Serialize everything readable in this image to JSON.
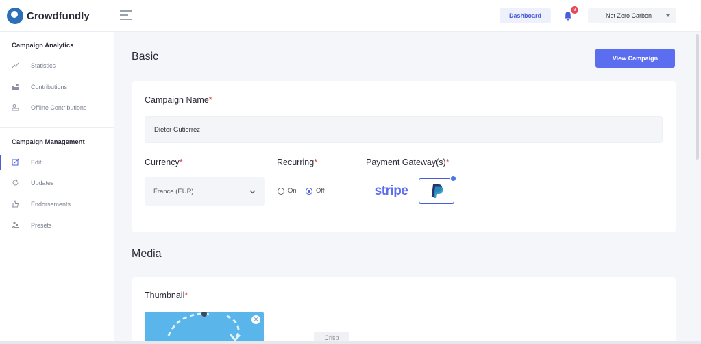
{
  "brand": {
    "name": "Crowdfundly",
    "color": "#2c6fb7"
  },
  "header": {
    "dashboard_label": "Dashboard",
    "notification_count": "9",
    "account_label": "Net Zero Carbon"
  },
  "sidebar": {
    "analytics_heading": "Campaign Analytics",
    "analytics_items": [
      {
        "label": "Statistics",
        "icon": "chart-line-icon"
      },
      {
        "label": "Contributions",
        "icon": "contributions-icon"
      },
      {
        "label": "Offline Contributions",
        "icon": "offline-contributions-icon"
      }
    ],
    "management_heading": "Campaign Management",
    "management_items": [
      {
        "label": "Edit",
        "icon": "edit-icon",
        "active": true
      },
      {
        "label": "Updates",
        "icon": "refresh-icon"
      },
      {
        "label": "Endorsements",
        "icon": "thumbs-up-icon"
      },
      {
        "label": "Presets",
        "icon": "sliders-icon"
      }
    ]
  },
  "basic": {
    "title": "Basic",
    "view_campaign_label": "View Campaign",
    "campaign_name_label": "Campaign Name",
    "campaign_name_value": "Dieter Gutierrez",
    "currency_label": "Currency",
    "currency_value": "France (EUR)",
    "recurring_label": "Recurring",
    "recurring_options": [
      "On",
      "Off"
    ],
    "recurring_selected": "Off",
    "payment_gateway_label": "Payment Gateway(s)",
    "gateways": [
      "stripe",
      "PayPal"
    ],
    "selected_gateway": "PayPal"
  },
  "media": {
    "title": "Media",
    "thumbnail_label": "Thumbnail"
  },
  "widget": {
    "crisp_label": "Crisp"
  },
  "colors": {
    "accent": "#5b6ef0",
    "required": "#e23a3a"
  }
}
